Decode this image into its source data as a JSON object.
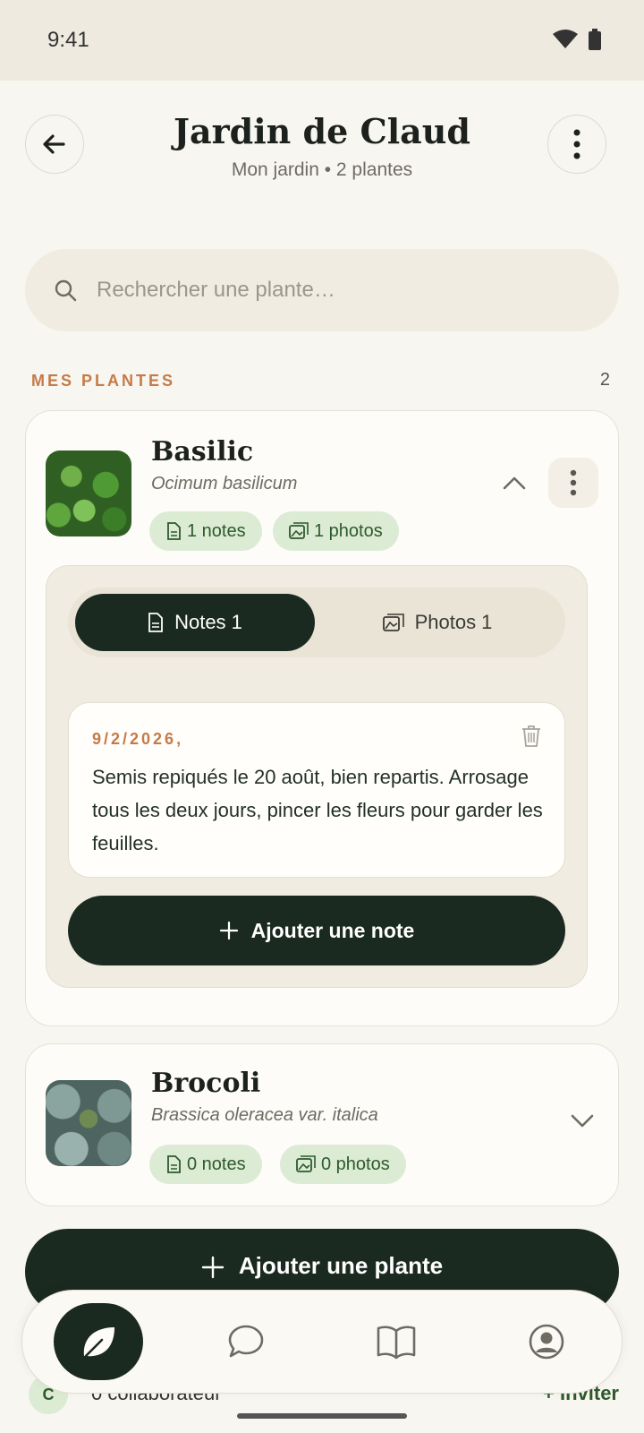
{
  "status_bar": {
    "time": "9:41",
    "icons": [
      "wifi-icon",
      "battery-icon"
    ]
  },
  "header": {
    "title": "Jardin de Claud",
    "subtitle": "Mon jardin • 2 plantes"
  },
  "search": {
    "placeholder": "Rechercher une plante…"
  },
  "section": {
    "title": "MES PLANTES",
    "count": "2"
  },
  "plants": [
    {
      "name": "Basilic",
      "latin": "Ocimum basilicum",
      "notes_chip": "1 notes",
      "photos_chip": "1 photos",
      "expanded": true,
      "tabs": {
        "notes": "Notes 1",
        "photos": "Photos 1",
        "active": "notes"
      },
      "note": {
        "date": "9/2/2026,",
        "text": "Semis repiqués le 20 août, bien repartis. Arrosage tous les deux jours, pincer les fleurs pour garder les feuilles."
      },
      "add_note_label": "Ajouter une note"
    },
    {
      "name": "Brocoli",
      "latin": "Brassica oleracea var. italica",
      "notes_chip": "0 notes",
      "photos_chip": "0 photos",
      "expanded": false
    }
  ],
  "add_plant_label": "Ajouter une plante",
  "collaborators": {
    "avatar_initial": "C",
    "text": "0 collaborateur",
    "invite_label": "+ Inviter"
  },
  "bottom_nav": {
    "items": [
      "leaf-icon",
      "chat-icon",
      "book-icon",
      "profile-icon"
    ],
    "active": "leaf-icon"
  },
  "colors": {
    "primary": "#1b2a20",
    "accent": "#c57a48",
    "chip_bg": "#dcebd4",
    "background": "#f8f6f0"
  }
}
